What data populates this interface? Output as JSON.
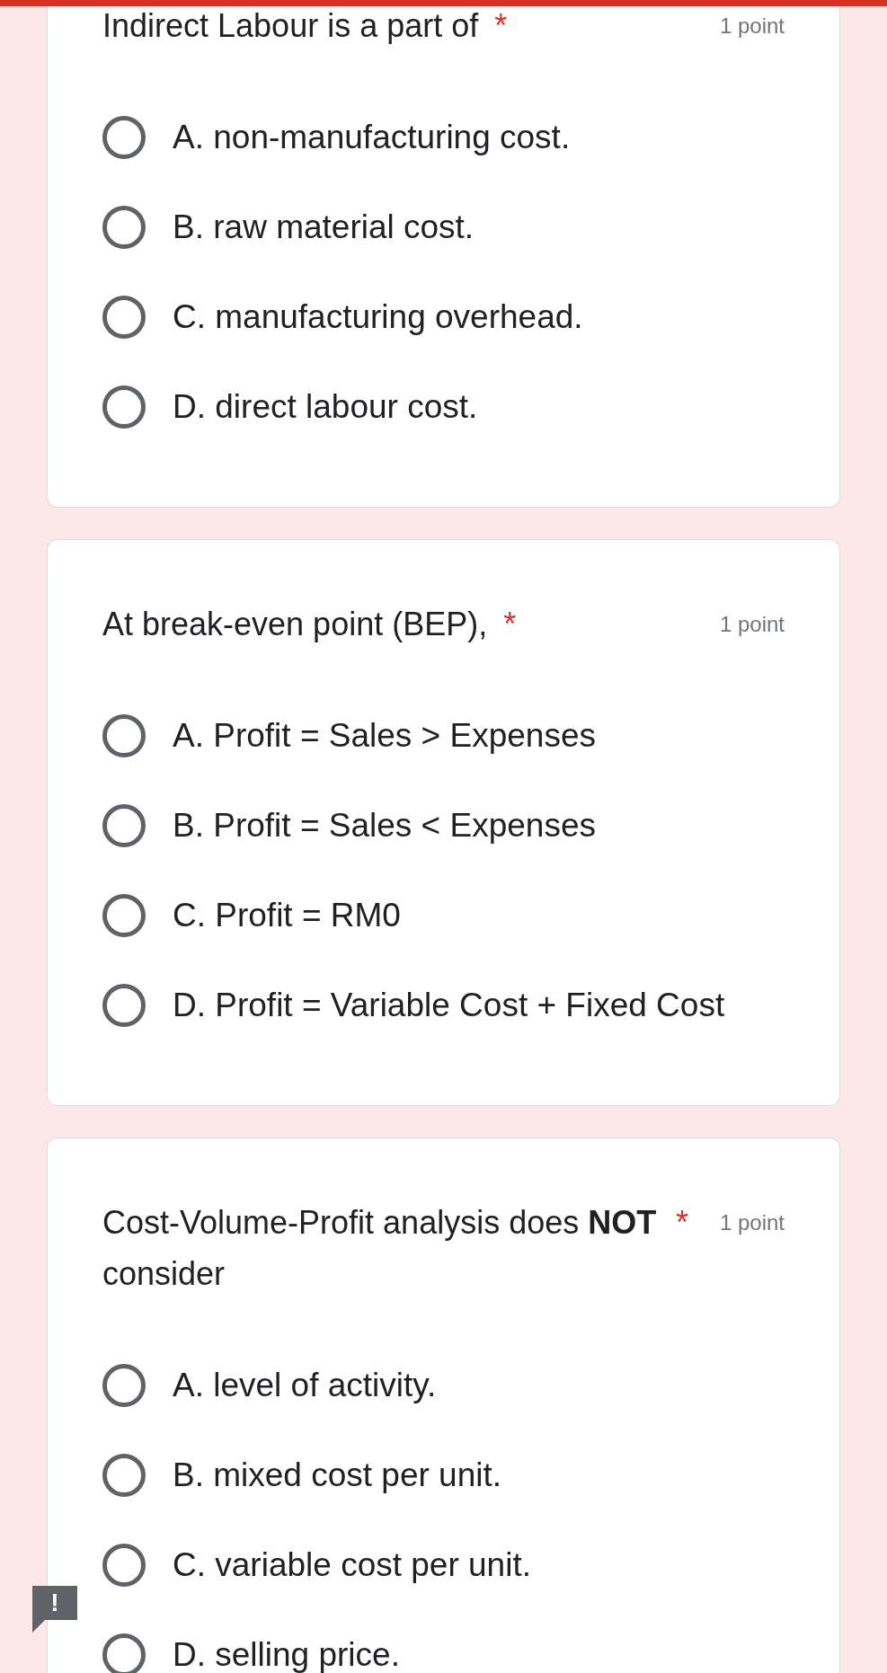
{
  "questions": [
    {
      "text": "Indirect Labour is a part of",
      "required_mark": "*",
      "points": "1 point",
      "options": [
        {
          "label": "A. non-manufacturing cost.",
          "selected": false
        },
        {
          "label": "B. raw material cost.",
          "selected": false
        },
        {
          "label": "C. manufacturing overhead.",
          "selected": false
        },
        {
          "label": "D. direct labour cost.",
          "selected": false
        }
      ]
    },
    {
      "text": "At break-even point (BEP),",
      "required_mark": "*",
      "points": "1 point",
      "options": [
        {
          "label": "A. Profit = Sales > Expenses",
          "selected": false
        },
        {
          "label": "B. Profit = Sales < Expenses",
          "selected": false
        },
        {
          "label": "C. Profit = RM0",
          "selected": false
        },
        {
          "label": "D. Profit = Variable Cost + Fixed Cost",
          "selected": false
        }
      ]
    },
    {
      "text": "Cost-Volume-Profit analysis does **NOT** consider",
      "required_mark": "*",
      "points": "1 point",
      "options": [
        {
          "label": "A. level of activity.",
          "selected": false
        },
        {
          "label": "B. mixed cost per unit.",
          "selected": false
        },
        {
          "label": "C. variable cost per unit.",
          "selected": false
        },
        {
          "label": "D. selling price.",
          "selected": false
        }
      ]
    }
  ],
  "alert_badge": "!"
}
